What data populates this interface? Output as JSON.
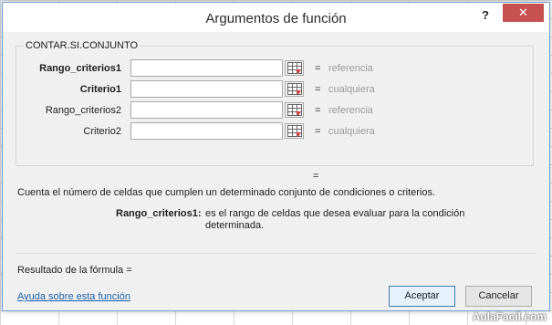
{
  "window": {
    "title": "Argumentos de función",
    "help_label": "?",
    "close_label": "✕"
  },
  "group": {
    "function_name": "CONTAR.SI.CONJUNTO"
  },
  "arguments": [
    {
      "label": "Rango_criterios1",
      "value": "",
      "equals": "=",
      "hint": "referencia"
    },
    {
      "label": "Criterio1",
      "value": "",
      "equals": "=",
      "hint": "cualquiera"
    },
    {
      "label": "Rango_criterios2",
      "value": "",
      "equals": "=",
      "hint": "referencia"
    },
    {
      "label": "Criterio2",
      "value": "",
      "equals": "=",
      "hint": "cualquiera"
    }
  ],
  "result_equals": "=",
  "description": "Cuenta el número de celdas que cumplen un determinado conjunto de condiciones o criterios.",
  "parameter": {
    "name": "Rango_criterios1:",
    "description": "es el rango de celdas que desea evaluar para la condición determinada."
  },
  "formula_result_label": "Resultado de la fórmula =",
  "help_link": "Ayuda sobre esta función",
  "buttons": {
    "ok": "Aceptar",
    "cancel": "Cancelar"
  },
  "watermark": "AulaFacil.com",
  "icons": {
    "range_selector": "range-selector-icon"
  }
}
